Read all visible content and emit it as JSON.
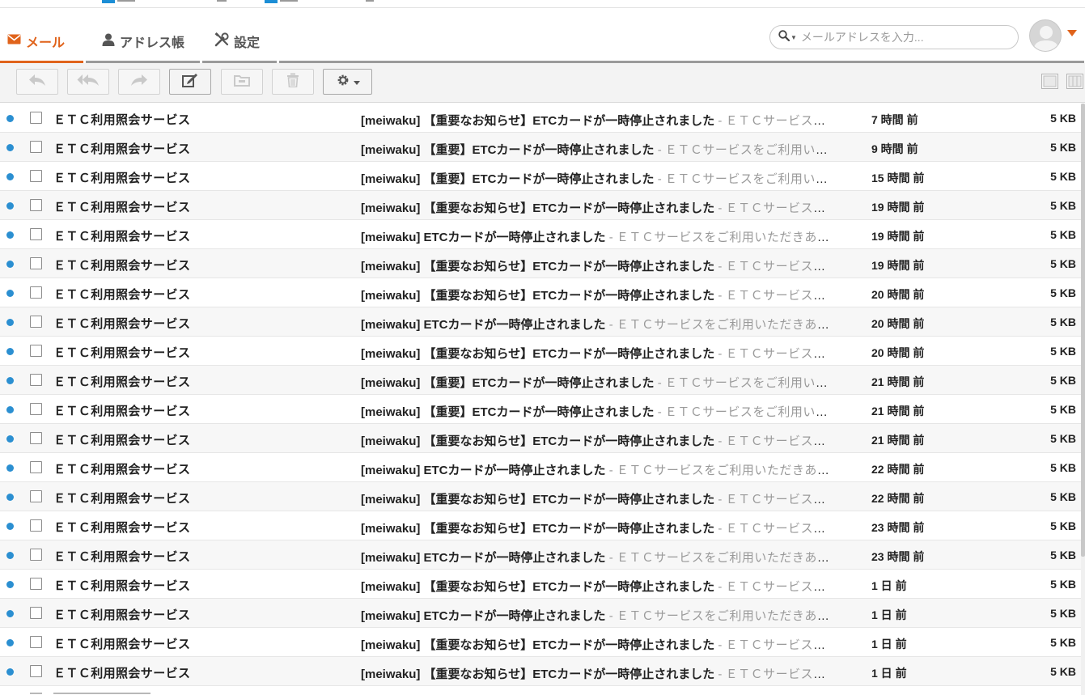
{
  "header": {
    "tabs": [
      {
        "label": "メール",
        "icon": "envelope-icon",
        "active": true
      },
      {
        "label": "アドレス帳",
        "icon": "person-icon",
        "active": false
      },
      {
        "label": "設定",
        "icon": "tools-icon",
        "active": false
      }
    ],
    "search": {
      "placeholder": "メールアドレスを入力..."
    },
    "accent_color": "#e0631b"
  },
  "toolbar": {
    "buttons": [
      {
        "name": "reply-button",
        "icon": "reply-icon",
        "enabled": false
      },
      {
        "name": "reply-all-button",
        "icon": "reply-all-icon",
        "enabled": false
      },
      {
        "name": "forward-button",
        "icon": "forward-icon",
        "enabled": false
      },
      {
        "name": "compose-button",
        "icon": "compose-icon",
        "enabled": true
      },
      {
        "name": "move-button",
        "icon": "folder-icon",
        "enabled": false
      },
      {
        "name": "delete-button",
        "icon": "trash-icon",
        "enabled": false
      },
      {
        "name": "settings-menu-button",
        "icon": "gear-icon",
        "enabled": true
      }
    ],
    "view_buttons": [
      "single-pane-icon",
      "split-pane-icon"
    ]
  },
  "mail_list": {
    "unread_dot_color": "#2b8fd1",
    "rows": [
      {
        "sender": "ＥＴＣ利用照会サービス",
        "subject": "[meiwaku] 【重要なお知らせ】ETCカードが一時停止されました",
        "preview": "ＥＴＣサービスを...",
        "time": "7 時間 前",
        "size": "5 KB"
      },
      {
        "sender": "ＥＴＣ利用照会サービス",
        "subject": "[meiwaku] 【重要】ETCカードが一時停止されました",
        "preview": "ＥＴＣサービスをご利用いた...",
        "time": "9 時間 前",
        "size": "5 KB"
      },
      {
        "sender": "ＥＴＣ利用照会サービス",
        "subject": "[meiwaku] 【重要】ETCカードが一時停止されました",
        "preview": "ＥＴＣサービスをご利用いた...",
        "time": "15 時間 前",
        "size": "5 KB"
      },
      {
        "sender": "ＥＴＣ利用照会サービス",
        "subject": "[meiwaku] 【重要なお知らせ】ETCカードが一時停止されました",
        "preview": "ＥＴＣサービスを...",
        "time": "19 時間 前",
        "size": "5 KB"
      },
      {
        "sender": "ＥＴＣ利用照会サービス",
        "subject": "[meiwaku] ETCカードが一時停止されました",
        "preview": "ＥＴＣサービスをご利用いただきあり...",
        "time": "19 時間 前",
        "size": "5 KB"
      },
      {
        "sender": "ＥＴＣ利用照会サービス",
        "subject": "[meiwaku] 【重要なお知らせ】ETCカードが一時停止されました",
        "preview": "ＥＴＣサービスを...",
        "time": "19 時間 前",
        "size": "5 KB"
      },
      {
        "sender": "ＥＴＣ利用照会サービス",
        "subject": "[meiwaku] 【重要なお知らせ】ETCカードが一時停止されました",
        "preview": "ＥＴＣサービスを...",
        "time": "20 時間 前",
        "size": "5 KB"
      },
      {
        "sender": "ＥＴＣ利用照会サービス",
        "subject": "[meiwaku] ETCカードが一時停止されました",
        "preview": "ＥＴＣサービスをご利用いただきあり...",
        "time": "20 時間 前",
        "size": "5 KB"
      },
      {
        "sender": "ＥＴＣ利用照会サービス",
        "subject": "[meiwaku] 【重要なお知らせ】ETCカードが一時停止されました",
        "preview": "ＥＴＣサービスを...",
        "time": "20 時間 前",
        "size": "5 KB"
      },
      {
        "sender": "ＥＴＣ利用照会サービス",
        "subject": "[meiwaku] 【重要】ETCカードが一時停止されました",
        "preview": "ＥＴＣサービスをご利用いた...",
        "time": "21 時間 前",
        "size": "5 KB"
      },
      {
        "sender": "ＥＴＣ利用照会サービス",
        "subject": "[meiwaku] 【重要】ETCカードが一時停止されました",
        "preview": "ＥＴＣサービスをご利用いた...",
        "time": "21 時間 前",
        "size": "5 KB"
      },
      {
        "sender": "ＥＴＣ利用照会サービス",
        "subject": "[meiwaku] 【重要なお知らせ】ETCカードが一時停止されました",
        "preview": "ＥＴＣサービスを...",
        "time": "21 時間 前",
        "size": "5 KB"
      },
      {
        "sender": "ＥＴＣ利用照会サービス",
        "subject": "[meiwaku] ETCカードが一時停止されました",
        "preview": "ＥＴＣサービスをご利用いただきあり...",
        "time": "22 時間 前",
        "size": "5 KB"
      },
      {
        "sender": "ＥＴＣ利用照会サービス",
        "subject": "[meiwaku] 【重要なお知らせ】ETCカードが一時停止されました",
        "preview": "ＥＴＣサービスを...",
        "time": "22 時間 前",
        "size": "5 KB"
      },
      {
        "sender": "ＥＴＣ利用照会サービス",
        "subject": "[meiwaku] 【重要なお知らせ】ETCカードが一時停止されました",
        "preview": "ＥＴＣサービスを...",
        "time": "23 時間 前",
        "size": "5 KB"
      },
      {
        "sender": "ＥＴＣ利用照会サービス",
        "subject": "[meiwaku] ETCカードが一時停止されました",
        "preview": "ＥＴＣサービスをご利用いただきあり...",
        "time": "23 時間 前",
        "size": "5 KB"
      },
      {
        "sender": "ＥＴＣ利用照会サービス",
        "subject": "[meiwaku] 【重要なお知らせ】ETCカードが一時停止されました",
        "preview": "ＥＴＣサービスを...",
        "time": "1 日 前",
        "size": "5 KB"
      },
      {
        "sender": "ＥＴＣ利用照会サービス",
        "subject": "[meiwaku] ETCカードが一時停止されました",
        "preview": "ＥＴＣサービスをご利用いただきあり...",
        "time": "1 日 前",
        "size": "5 KB"
      },
      {
        "sender": "ＥＴＣ利用照会サービス",
        "subject": "[meiwaku] 【重要なお知らせ】ETCカードが一時停止されました",
        "preview": "ＥＴＣサービスを...",
        "time": "1 日 前",
        "size": "5 KB"
      },
      {
        "sender": "ＥＴＣ利用照会サービス",
        "subject": "[meiwaku] 【重要なお知らせ】ETCカードが一時停止されました",
        "preview": "ＥＴＣサービスを...",
        "time": "1 日 前",
        "size": "5 KB"
      }
    ]
  }
}
